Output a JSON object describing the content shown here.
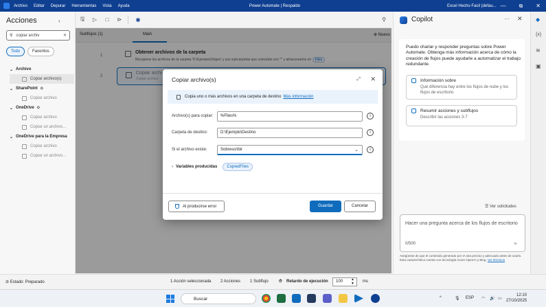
{
  "titlebar": {
    "menu": [
      "Archivo",
      "Editar",
      "Depurar",
      "Herramientas",
      "Vista",
      "Ayuda"
    ],
    "title": "Power Automate | Respaldo",
    "account": "Excel Hecho Facil (defau...",
    "controls": [
      "—",
      "⧉",
      "✕"
    ]
  },
  "actions": {
    "title": "Acciones",
    "search_value": "copiar archiv",
    "filters": [
      "Todo",
      "Favoritos"
    ],
    "groups": [
      {
        "label": "Archivo",
        "items": [
          "Copiar archivo(s)"
        ]
      },
      {
        "label": "SharePoint",
        "items": [
          "Copiar archivo"
        ]
      },
      {
        "label": "OneDrive",
        "items": [
          "Copiar archivo",
          "Copiar un archivo..."
        ]
      },
      {
        "label": "OneDrive para la Empresa",
        "items": [
          "Copiar archivo",
          "Copiar un archivo..."
        ]
      }
    ]
  },
  "editor": {
    "subflows_label": "Subflujos (1)",
    "main_tab": "Main",
    "new_label": "Nuevo",
    "steps": [
      {
        "num": "1",
        "title": "Obtener archivos de la carpeta",
        "desc_prefix": "Recuperar los archivos de la carpeta 'D:\\Ejemplo\\Origen' y sus subcarpetas que coincidan con '*' y almacenarlos en",
        "badge": "Files"
      },
      {
        "num": "2",
        "title": "Copiar archivo(s)",
        "desc": "Copiar archivo"
      }
    ]
  },
  "dialog": {
    "title": "Copiar archivo(s)",
    "info_text": "Copia uno o más archivos en una carpeta de destino",
    "info_link": "Más información",
    "fields": [
      {
        "label": "Archivo(s) para copiar:",
        "value": "%Files%"
      },
      {
        "label": "Carpeta de destino:",
        "value": "D:\\Ejemplo\\Destino"
      },
      {
        "label": "Si el archivo existe:",
        "value": "Sobrescribir"
      }
    ],
    "vars_label": "Variables producidas",
    "vars_chip": "CopiedFiles",
    "error_button": "Al producirse error",
    "save_button": "Guardar",
    "cancel_button": "Cancelar"
  },
  "copilot": {
    "title": "Copilot",
    "intro": "Puedo charlar y responder preguntas sobre Power Automate. Obtenga más información acerca de cómo la creación de flujos puede ayudarle a automatizar el trabajo redundante.",
    "cards": [
      {
        "title": "Información sobre",
        "desc": "Qué diferencia hay entre los flujos de nube y los flujos de escritorio"
      },
      {
        "title": "Resumir acciones y subflujos",
        "desc": "Describir las acciones 3-7"
      }
    ],
    "ver_solicitudes": "Ver solicitudes",
    "input_placeholder": "Hacer una pregunta acerca de los flujos de escritorio",
    "counter": "0/500",
    "disclaimer": "Asegúrese de que el contenido generado por IA sea preciso y adecuado antes de usarlo. Esta característica cuenta con tecnología Azure OpenAI y Bing",
    "disclaimer_link": "Ver términos"
  },
  "status": {
    "state": "Estado: Preparado",
    "selected": "1 Acción seleccionada",
    "actions": "2 Acciones",
    "subflows": "1 Subflujo",
    "delay_label": "Retardo de ejecución",
    "delay_value": "100",
    "unit": "ms"
  },
  "taskbar": {
    "search": "Buscar",
    "lang": "ESP",
    "time": "12:10",
    "date": "27/10/2025"
  },
  "colors": {
    "titlebar": "#0f3f91",
    "accent": "#0f6cbd"
  }
}
